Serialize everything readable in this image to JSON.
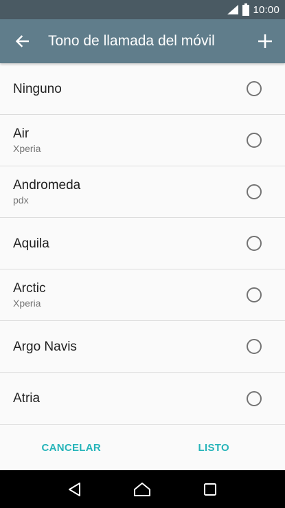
{
  "status_bar": {
    "time": "10:00",
    "icons": [
      "signal-icon",
      "battery-icon"
    ]
  },
  "app_bar": {
    "back_icon": "arrow-left-icon",
    "title": "Tono de llamada del móvil",
    "add_icon": "plus-icon"
  },
  "ringtones": [
    {
      "title": "Ninguno",
      "subtitle": "",
      "selected": false
    },
    {
      "title": "Air",
      "subtitle": "Xperia",
      "selected": false
    },
    {
      "title": "Andromeda",
      "subtitle": "pdx",
      "selected": false
    },
    {
      "title": "Aquila",
      "subtitle": "",
      "selected": false
    },
    {
      "title": "Arctic",
      "subtitle": "Xperia",
      "selected": false
    },
    {
      "title": "Argo Navis",
      "subtitle": "",
      "selected": false
    },
    {
      "title": "Atria",
      "subtitle": "",
      "selected": false
    }
  ],
  "buttons": {
    "cancel": "CANCELAR",
    "done": "LISTO"
  },
  "nav_bar": {
    "icons": [
      "back-triangle-icon",
      "home-icon",
      "recents-icon"
    ]
  },
  "colors": {
    "app_bar": "#607d8b",
    "status_bar": "#4a5a63",
    "accent": "#26b4b9"
  }
}
